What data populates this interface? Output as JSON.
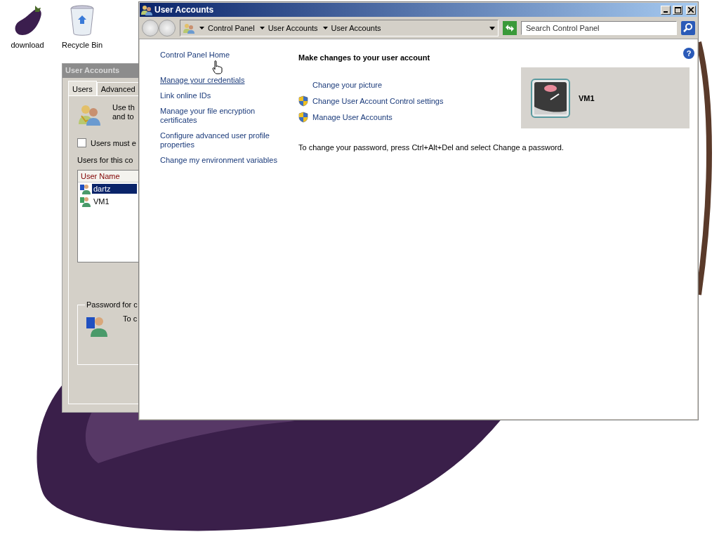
{
  "desktop_icons": [
    {
      "label": "download",
      "kind": "eggplant"
    },
    {
      "label": "Recycle Bin",
      "kind": "bin"
    }
  ],
  "back_window": {
    "title": "User Accounts",
    "tabs": [
      {
        "label": "Users",
        "selected": true
      },
      {
        "label": "Advanced",
        "selected": false
      }
    ],
    "intro_lines": [
      "Use th",
      "and to"
    ],
    "checkbox": {
      "label": "Users must e",
      "checked": false
    },
    "users_label": "Users for this co",
    "list": {
      "column": "User Name",
      "rows": [
        {
          "name": "dartz",
          "selected": true
        },
        {
          "name": "VM1",
          "selected": false
        }
      ]
    },
    "password_group": {
      "title": "Password for c",
      "text": "To c"
    }
  },
  "main_window": {
    "title": "User Accounts",
    "breadcrumbs": [
      "Control Panel",
      "User Accounts",
      "User Accounts"
    ],
    "search": {
      "placeholder": "Search Control Panel"
    },
    "sidebar_links": [
      {
        "label": "Control Panel Home",
        "hovered": false
      },
      {
        "label": "Manage your credentials",
        "hovered": true
      },
      {
        "label": "Link online IDs",
        "hovered": false
      },
      {
        "label": "Manage your file encryption certificates",
        "hovered": false
      },
      {
        "label": "Configure advanced user profile properties",
        "hovered": false
      },
      {
        "label": "Change my environment variables",
        "hovered": false
      }
    ],
    "heading": "Make changes to your user account",
    "tasks": [
      {
        "label": "Change your picture",
        "kind": "plain"
      },
      {
        "label": "Change User Account Control settings",
        "kind": "shield"
      },
      {
        "label": "Manage User Accounts",
        "kind": "shield"
      }
    ],
    "account": {
      "name": "VM1"
    },
    "help_label": "?",
    "note": "To change your password, press Ctrl+Alt+Del and select Change a password."
  }
}
